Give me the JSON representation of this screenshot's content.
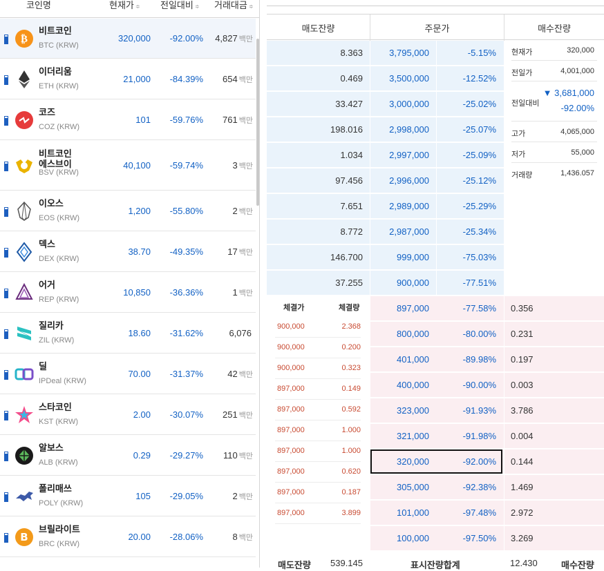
{
  "coin_list": {
    "headers": {
      "name": "코인명",
      "price": "현재가",
      "change": "전일대비",
      "volume": "거래대금",
      "sort_glyph": "≑"
    },
    "volume_unit": "백만",
    "coins": [
      {
        "name": "비트코인",
        "symbol": "BTC (KRW)",
        "price": "320,000",
        "change": "-92.00%",
        "volume": "4,827",
        "unit": "백만",
        "icon": "bitcoin-icon"
      },
      {
        "name": "이더리움",
        "symbol": "ETH (KRW)",
        "price": "21,000",
        "change": "-84.39%",
        "volume": "654",
        "unit": "백만",
        "icon": "ethereum-icon"
      },
      {
        "name": "코즈",
        "symbol": "COZ (KRW)",
        "price": "101",
        "change": "-59.76%",
        "volume": "761",
        "unit": "백만",
        "icon": "cosmo-icon"
      },
      {
        "name": "비트코인\n에스브이",
        "name_line1": "비트코인",
        "name_line2": "에스브이",
        "symbol": "BSV (KRW)",
        "price": "40,100",
        "change": "-59.74%",
        "volume": "3",
        "unit": "백만",
        "icon": "bsv-icon"
      },
      {
        "name": "이오스",
        "symbol": "EOS (KRW)",
        "price": "1,200",
        "change": "-55.80%",
        "volume": "2",
        "unit": "백만",
        "icon": "eos-icon"
      },
      {
        "name": "덱스",
        "symbol": "DEX (KRW)",
        "price": "38.70",
        "change": "-49.35%",
        "volume": "17",
        "unit": "백만",
        "icon": "dex-icon"
      },
      {
        "name": "어거",
        "symbol": "REP (KRW)",
        "price": "10,850",
        "change": "-36.36%",
        "volume": "1",
        "unit": "백만",
        "icon": "augur-icon"
      },
      {
        "name": "질리카",
        "symbol": "ZIL (KRW)",
        "price": "18.60",
        "change": "-31.62%",
        "volume": "6,076",
        "unit": "",
        "icon": "zilliqa-icon"
      },
      {
        "name": "딜",
        "symbol": "IPDeal (KRW)",
        "price": "70.00",
        "change": "-31.37%",
        "volume": "42",
        "unit": "백만",
        "icon": "ipdeal-icon"
      },
      {
        "name": "스타코인",
        "symbol": "KST (KRW)",
        "price": "2.00",
        "change": "-30.07%",
        "volume": "251",
        "unit": "백만",
        "icon": "starcoin-icon"
      },
      {
        "name": "알보스",
        "symbol": "ALB (KRW)",
        "price": "0.29",
        "change": "-29.27%",
        "volume": "110",
        "unit": "백만",
        "icon": "albos-icon"
      },
      {
        "name": "폴리매쓰",
        "symbol": "POLY (KRW)",
        "price": "105",
        "change": "-29.05%",
        "volume": "2",
        "unit": "백만",
        "icon": "polymath-icon"
      },
      {
        "name": "브릴라이트",
        "symbol": "BRC (KRW)",
        "price": "20.00",
        "change": "-28.06%",
        "volume": "8",
        "unit": "백만",
        "icon": "brilliant-icon"
      }
    ]
  },
  "orderbook": {
    "headers": {
      "ask": "매도잔량",
      "price": "주문가",
      "bid": "매수잔량"
    },
    "asks": [
      {
        "volume": "8.363",
        "price": "3,795,000",
        "pct": "-5.15%"
      },
      {
        "volume": "0.469",
        "price": "3,500,000",
        "pct": "-12.52%"
      },
      {
        "volume": "33.427",
        "price": "3,000,000",
        "pct": "-25.02%"
      },
      {
        "volume": "198.016",
        "price": "2,998,000",
        "pct": "-25.07%"
      },
      {
        "volume": "1.034",
        "price": "2,997,000",
        "pct": "-25.09%"
      },
      {
        "volume": "97.456",
        "price": "2,996,000",
        "pct": "-25.12%"
      },
      {
        "volume": "7.651",
        "price": "2,989,000",
        "pct": "-25.29%"
      },
      {
        "volume": "8.772",
        "price": "2,987,000",
        "pct": "-25.34%"
      },
      {
        "volume": "146.700",
        "price": "999,000",
        "pct": "-75.03%"
      },
      {
        "volume": "37.255",
        "price": "900,000",
        "pct": "-77.51%"
      }
    ],
    "bids": [
      {
        "price": "897,000",
        "pct": "-77.58%",
        "volume": "0.356"
      },
      {
        "price": "800,000",
        "pct": "-80.00%",
        "volume": "0.231"
      },
      {
        "price": "401,000",
        "pct": "-89.98%",
        "volume": "0.197"
      },
      {
        "price": "400,000",
        "pct": "-90.00%",
        "volume": "0.003"
      },
      {
        "price": "323,000",
        "pct": "-91.93%",
        "volume": "3.786"
      },
      {
        "price": "321,000",
        "pct": "-91.98%",
        "volume": "0.004"
      },
      {
        "price": "320,000",
        "pct": "-92.00%",
        "volume": "0.144"
      },
      {
        "price": "305,000",
        "pct": "-92.38%",
        "volume": "1.469"
      },
      {
        "price": "101,000",
        "pct": "-97.48%",
        "volume": "2.972"
      },
      {
        "price": "100,000",
        "pct": "-97.50%",
        "volume": "3.269"
      }
    ],
    "info": {
      "current_label": "현재가",
      "current_value": "320,000",
      "prev_label": "전일가",
      "prev_value": "4,001,000",
      "diff_label": "전일대비",
      "diff_arrow": "▼",
      "diff_value": "3,681,000",
      "diff_pct": "-92.00%",
      "high_label": "고가",
      "high_value": "4,065,000",
      "low_label": "저가",
      "low_value": "55,000",
      "volume_label": "거래량",
      "volume_value": "1,436.057"
    },
    "trades": {
      "price_header": "체결가",
      "qty_header": "체결량",
      "rows": [
        {
          "price": "900,000",
          "qty": "2.368"
        },
        {
          "price": "900,000",
          "qty": "0.200"
        },
        {
          "price": "900,000",
          "qty": "0.323"
        },
        {
          "price": "897,000",
          "qty": "0.149"
        },
        {
          "price": "897,000",
          "qty": "0.592"
        },
        {
          "price": "897,000",
          "qty": "1.000"
        },
        {
          "price": "897,000",
          "qty": "1.000"
        },
        {
          "price": "897,000",
          "qty": "0.620"
        },
        {
          "price": "897,000",
          "qty": "0.187"
        },
        {
          "price": "897,000",
          "qty": "3.899"
        }
      ]
    },
    "footer": {
      "ask_label": "매도잔량",
      "ask_total": "539.145",
      "center_label": "표시잔량합계",
      "bid_total": "12.430",
      "bid_label": "매수잔량"
    }
  },
  "colors": {
    "blue": "#1261c4",
    "red": "#c84a31",
    "ask_bg": "#eaf3fb",
    "bid_bg": "#fbeef1"
  }
}
